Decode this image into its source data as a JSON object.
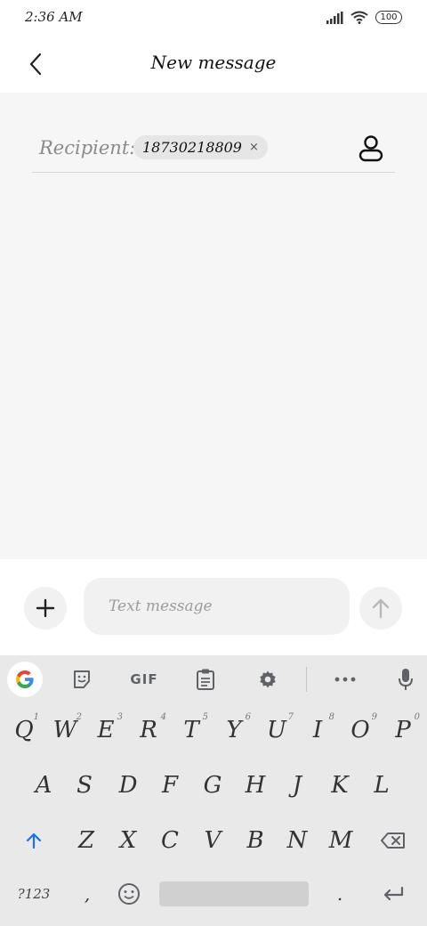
{
  "status_bar": {
    "time": "2:36 AM",
    "battery": "100"
  },
  "header": {
    "title": "New message"
  },
  "recipient": {
    "label": "Recipient:",
    "chip": "18730218809",
    "chip_close": "×"
  },
  "compose": {
    "placeholder": "Text message"
  },
  "keyboard": {
    "toolbar": {
      "gif": "GIF"
    },
    "row1": [
      {
        "k": "Q",
        "h": "1"
      },
      {
        "k": "W",
        "h": "2"
      },
      {
        "k": "E",
        "h": "3"
      },
      {
        "k": "R",
        "h": "4"
      },
      {
        "k": "T",
        "h": "5"
      },
      {
        "k": "Y",
        "h": "6"
      },
      {
        "k": "U",
        "h": "7"
      },
      {
        "k": "I",
        "h": "8"
      },
      {
        "k": "O",
        "h": "9"
      },
      {
        "k": "P",
        "h": "0"
      }
    ],
    "row2": [
      "A",
      "S",
      "D",
      "F",
      "G",
      "H",
      "J",
      "K",
      "L"
    ],
    "row3": [
      "Z",
      "X",
      "C",
      "V",
      "B",
      "N",
      "M"
    ],
    "symbols": "?123",
    "comma": ",",
    "period": "."
  },
  "colors": {
    "accent_blue": "#1a73e8",
    "main_bg": "#f6f6f6",
    "keyboard_bg": "#e9e9ea"
  },
  "icons": [
    "back-arrow-icon",
    "signal-icon",
    "wifi-icon",
    "contact-icon",
    "plus-icon",
    "send-arrow-icon",
    "google-icon",
    "sticker-icon",
    "clipboard-icon",
    "gear-icon",
    "more-icon",
    "mic-icon",
    "shift-icon",
    "backspace-icon",
    "emoji-icon",
    "enter-icon"
  ]
}
